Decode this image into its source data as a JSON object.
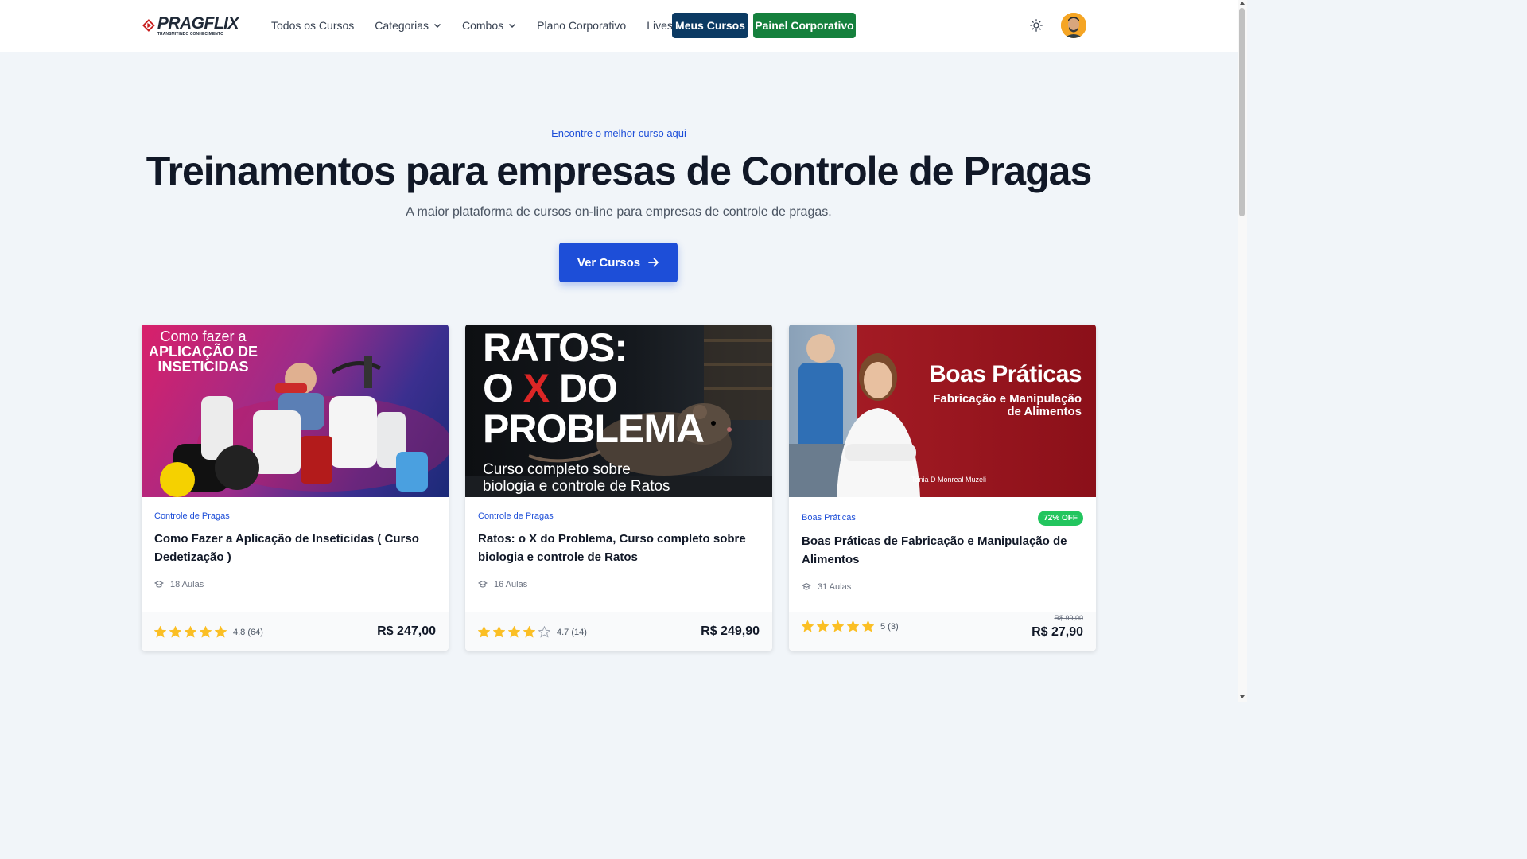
{
  "header": {
    "logo_word": "PRAGFLIX",
    "logo_tagline": "TRANSMITINDO CONHECIMENTO",
    "nav": [
      {
        "label": "Todos os Cursos"
      },
      {
        "label": "Categorias"
      },
      {
        "label": "Combos"
      },
      {
        "label": "Plano Corporativo"
      },
      {
        "label": "Lives"
      }
    ],
    "meus_cursos": "Meus Cursos",
    "painel_corporativo": "Painel Corporativo"
  },
  "hero": {
    "eyebrow": "Encontre o melhor curso aqui",
    "title": "Treinamentos para empresas de Controle de Pragas",
    "subtitle": "A maior plataforma de cursos on-line para empresas de controle de pragas.",
    "cta": "Ver Cursos"
  },
  "courses": [
    {
      "category": "Controle de Pragas",
      "title": "Como Fazer a Aplicação de Inseticidas ( Curso Dedetização )",
      "lessons": "18 Aulas",
      "rating": 4.8,
      "rating_text": "4.8 (64)",
      "price": "R$ 247,00",
      "thumb_line1": "Como fazer a",
      "thumb_line2": "APLICAÇÃO DE",
      "thumb_line3": "INSETICIDAS"
    },
    {
      "category": "Controle de Pragas",
      "title": "Ratos: o X do Problema, Curso completo sobre biologia e controle de Ratos",
      "lessons": "16 Aulas",
      "rating": 4.7,
      "rating_text": "4.7 (14)",
      "price": "R$ 249,90",
      "thumb_line1": "RATOS:",
      "thumb_line2a": "O ",
      "thumb_line2x": "X",
      "thumb_line2b": " DO",
      "thumb_line3": "PROBLEMA",
      "thumb_sub1": "Curso completo sobre",
      "thumb_sub2": "biologia e controle de Ratos"
    },
    {
      "category": "Boas Práticas",
      "badge": "72% OFF",
      "title": "Boas Práticas de Fabricação e Manipulação de Alimentos",
      "lessons": "31 Aulas",
      "rating": 5,
      "rating_text": "5 (3)",
      "old_price": "R$ 99,00",
      "price": "R$ 27,90",
      "thumb_title": "Boas Práticas",
      "thumb_sub1": "Fabricação e Manipulação",
      "thumb_sub2": "de Alimentos",
      "thumb_name": "Tania D Monreal Muzeli"
    }
  ],
  "colors": {
    "primary": "#1d4ed8",
    "navy": "#0b3a63",
    "green": "#15803d",
    "star": "#fbbf24"
  }
}
